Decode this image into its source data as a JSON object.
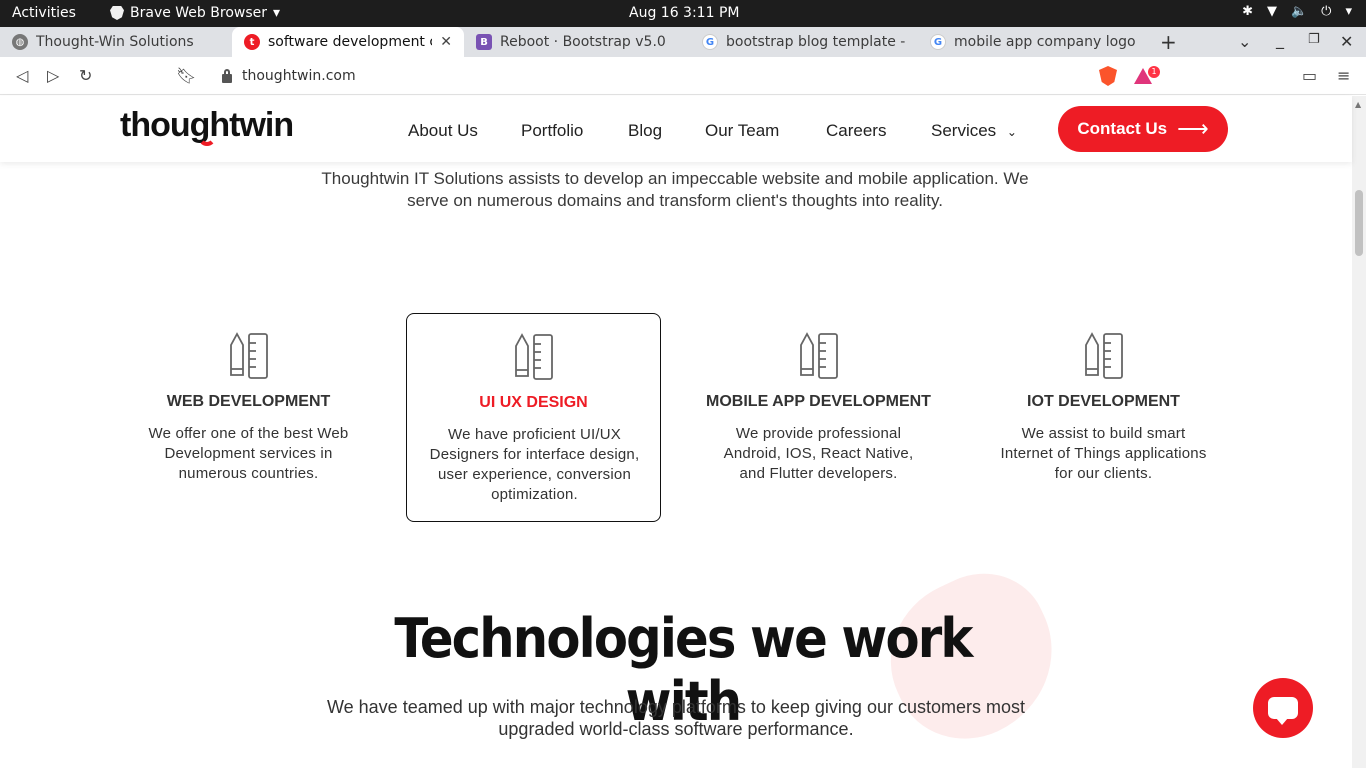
{
  "os_bar": {
    "activities": "Activities",
    "app_name": "Brave Web Browser",
    "clock": "Aug 16  3:11 PM"
  },
  "tabs": [
    {
      "label": "Thought-Win Solutions",
      "favicon": "globe-icon"
    },
    {
      "label": "software development c",
      "favicon": "thoughtwin-icon",
      "active": true
    },
    {
      "label": "Reboot · Bootstrap v5.0",
      "favicon": "bootstrap-icon"
    },
    {
      "label": "bootstrap blog template - G",
      "favicon": "google-icon"
    },
    {
      "label": "mobile app company logo - G",
      "favicon": "google-icon"
    }
  ],
  "address_bar": {
    "url": "thoughtwin.com",
    "rewards_badge": "1"
  },
  "site": {
    "logo": "thoughtwin",
    "nav": [
      "About Us",
      "Portfolio",
      "Blog",
      "Our Team",
      "Careers",
      "Services"
    ],
    "contact_label": "Contact Us",
    "intro": "Thoughtwin IT Solutions assists to develop an impeccable website and mobile application. We serve on numerous domains and transform client's thoughts into reality.",
    "services": [
      {
        "title": "WEB DEVELOPMENT",
        "desc": "We offer one of the best Web Development services in numerous countries."
      },
      {
        "title": "UI UX DESIGN",
        "desc": "We have proficient UI/UX Designers for interface design, user experience, conversion optimization.",
        "active": true
      },
      {
        "title": "MOBILE APP DEVELOPMENT",
        "desc": "We provide professional Android, IOS, React Native, and Flutter developers."
      },
      {
        "title": "IOT DEVELOPMENT",
        "desc": "We assist to build smart Internet of Things applications for our clients."
      }
    ],
    "tech_title": "Technologies we work with",
    "tech_subtitle": "We have teamed up with major technology platforms to keep giving our customers most upgraded world-class software performance."
  },
  "colors": {
    "brand_red": "#ee1c25",
    "text_dark": "#111111"
  }
}
